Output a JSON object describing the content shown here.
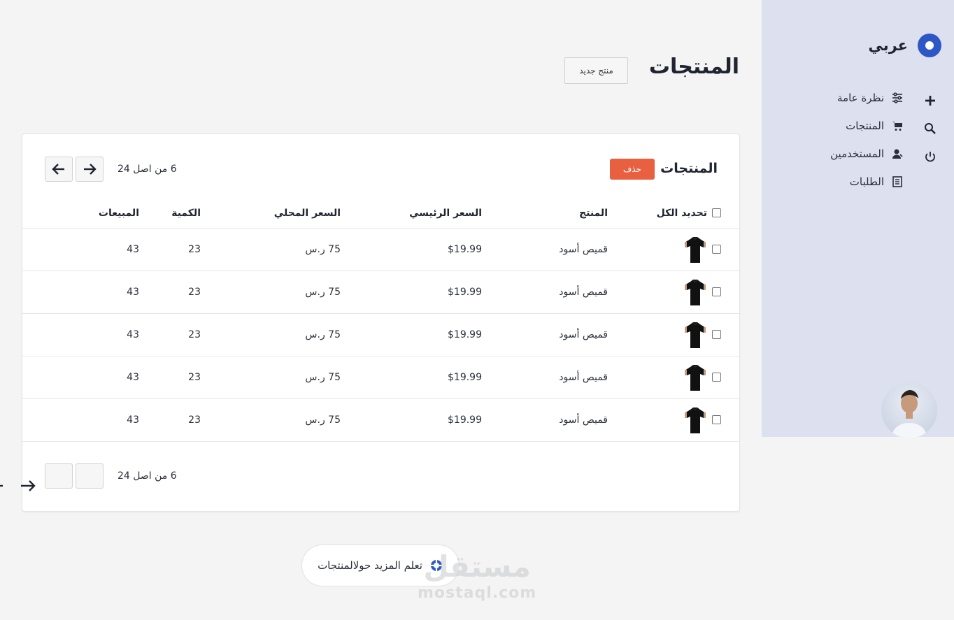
{
  "sidebar": {
    "brand": "عربي",
    "items": [
      {
        "label": "نظرة عامة",
        "icon": "sliders-icon"
      },
      {
        "label": "المنتجات",
        "icon": "cart-icon"
      },
      {
        "label": "المستخدمين",
        "icon": "user-icon"
      },
      {
        "label": "الطلبات",
        "icon": "document-icon"
      }
    ],
    "side_icons": [
      "plus-icon",
      "search-icon",
      "power-icon"
    ]
  },
  "page": {
    "title": "المنتجات",
    "new_button": "منتج جديد"
  },
  "card": {
    "title": "المنتجات",
    "delete_button": "حذف",
    "pagination_text": "6 من اصل 24",
    "columns": {
      "select_all": "تحديد الكل",
      "product": "المنتج",
      "main_price": "السعر الرئيسي",
      "local_price": "السعر المحلي",
      "quantity": "الكمية",
      "sales": "المبيعات"
    },
    "rows": [
      {
        "name": "قميص أسود",
        "main_price": "$19.99",
        "local_price": "75 ر.س",
        "quantity": "23",
        "sales": "43"
      },
      {
        "name": "قميص أسود",
        "main_price": "$19.99",
        "local_price": "75 ر.س",
        "quantity": "23",
        "sales": "43"
      },
      {
        "name": "قميص أسود",
        "main_price": "$19.99",
        "local_price": "75 ر.س",
        "quantity": "23",
        "sales": "43"
      },
      {
        "name": "قميص أسود",
        "main_price": "$19.99",
        "local_price": "75 ر.س",
        "quantity": "23",
        "sales": "43"
      },
      {
        "name": "قميص أسود",
        "main_price": "$19.99",
        "local_price": "75 ر.س",
        "quantity": "23",
        "sales": "43"
      }
    ]
  },
  "learn_more": "تعلم المزيد حولالمنتجات",
  "watermark": {
    "arabic": "مستقل",
    "latin": "mostaql.com"
  },
  "colors": {
    "accent": "#2d57c4",
    "danger": "#e8603f",
    "sidebar_bg": "#dde0ee"
  }
}
